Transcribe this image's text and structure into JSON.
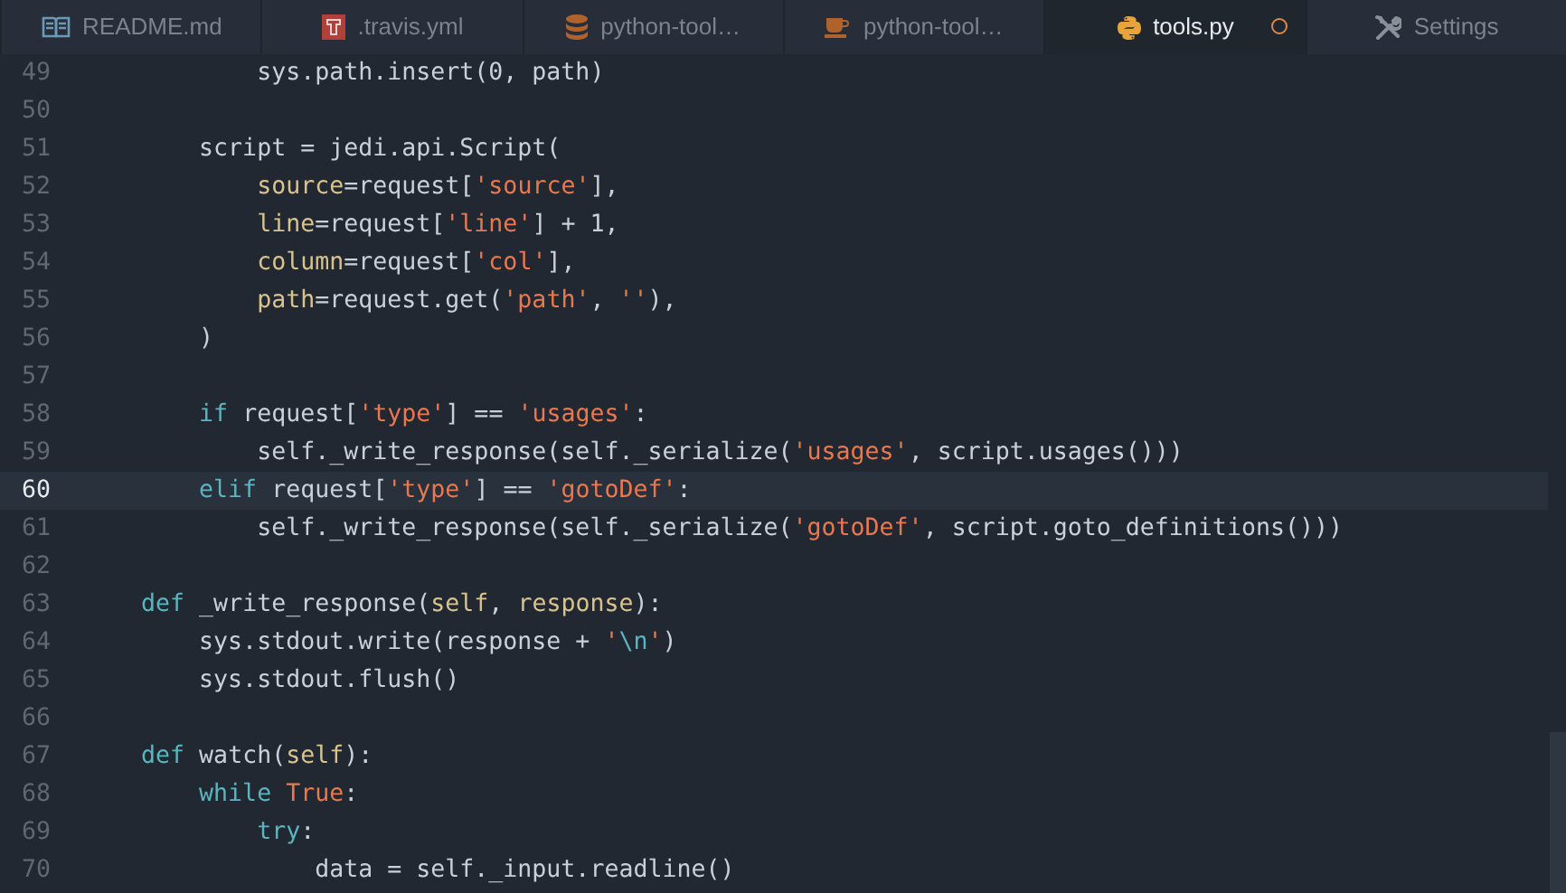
{
  "tabs": [
    {
      "label": "README.md",
      "selected": false,
      "modified": false
    },
    {
      "label": ".travis.yml",
      "selected": false,
      "modified": false
    },
    {
      "label": "python-tool…",
      "selected": false,
      "modified": false
    },
    {
      "label": "python-tool…",
      "selected": false,
      "modified": false
    },
    {
      "label": "tools.py",
      "selected": true,
      "modified": true
    },
    {
      "label": "Settings",
      "selected": false,
      "modified": false
    }
  ],
  "editor": {
    "lines": [
      {
        "number": "49",
        "current": false,
        "tokens": [
          {
            "t": "            sys.path.insert(0, path)",
            "kind": "plain"
          }
        ]
      },
      {
        "number": "50",
        "current": false
      },
      {
        "number": "51",
        "current": false,
        "tokens": [
          {
            "t": "        script = jedi.api.Script(",
            "kind": "plain"
          }
        ]
      },
      {
        "number": "52",
        "current": false,
        "tokens": [
          {
            "t": "            source",
            "kind": "param"
          },
          {
            "t": "=request[",
            "kind": "plain"
          },
          {
            "t": "'source'",
            "kind": "string"
          },
          {
            "t": "],",
            "kind": "plain"
          }
        ]
      },
      {
        "number": "53",
        "current": false,
        "tokens": [
          {
            "t": "            line",
            "kind": "param"
          },
          {
            "t": "=request[",
            "kind": "plain"
          },
          {
            "t": "'line'",
            "kind": "string"
          },
          {
            "t": "] + 1,",
            "kind": "plain"
          }
        ]
      },
      {
        "number": "54",
        "current": false,
        "tokens": [
          {
            "t": "            column",
            "kind": "param"
          },
          {
            "t": "=request[",
            "kind": "plain"
          },
          {
            "t": "'col'",
            "kind": "string"
          },
          {
            "t": "],",
            "kind": "plain"
          }
        ]
      },
      {
        "number": "55",
        "current": false,
        "tokens": [
          {
            "t": "            path",
            "kind": "param"
          },
          {
            "t": "=request.get(",
            "kind": "plain"
          },
          {
            "t": "'path'",
            "kind": "string"
          },
          {
            "t": ", ",
            "kind": "plain"
          },
          {
            "t": "''",
            "kind": "string"
          },
          {
            "t": "),",
            "kind": "plain"
          }
        ]
      },
      {
        "number": "56",
        "current": false,
        "tokens": [
          {
            "t": "        )",
            "kind": "plain"
          }
        ]
      },
      {
        "number": "57",
        "current": false
      },
      {
        "number": "58",
        "current": false,
        "tokens": [
          {
            "t": "        if",
            "kind": "keyword"
          },
          {
            "t": " request[",
            "kind": "plain"
          },
          {
            "t": "'type'",
            "kind": "string"
          },
          {
            "t": "] == ",
            "kind": "plain"
          },
          {
            "t": "'usages'",
            "kind": "string"
          },
          {
            "t": ":",
            "kind": "plain"
          }
        ]
      },
      {
        "number": "59",
        "current": false,
        "tokens": [
          {
            "t": "            self._write_response(self._serialize(",
            "kind": "plain"
          },
          {
            "t": "'usages'",
            "kind": "string"
          },
          {
            "t": ", script.usages()))",
            "kind": "plain"
          }
        ]
      },
      {
        "number": "60",
        "current": true,
        "tokens": [
          {
            "t": "        elif",
            "kind": "keyword"
          },
          {
            "t": " request[",
            "kind": "plain"
          },
          {
            "t": "'type'",
            "kind": "string"
          },
          {
            "t": "] == ",
            "kind": "plain"
          },
          {
            "t": "'gotoDef'",
            "kind": "string"
          },
          {
            "t": ":",
            "kind": "plain"
          }
        ]
      },
      {
        "number": "61",
        "current": false,
        "tokens": [
          {
            "t": "            self._write_response(self._serialize(",
            "kind": "plain"
          },
          {
            "t": "'gotoDef'",
            "kind": "string"
          },
          {
            "t": ", script.goto_definitions()))",
            "kind": "plain"
          }
        ]
      },
      {
        "number": "62",
        "current": false
      },
      {
        "number": "63",
        "current": false,
        "tokens": [
          {
            "t": "    def",
            "kind": "keyword"
          },
          {
            "t": " _write_response(",
            "kind": "plain"
          },
          {
            "t": "self",
            "kind": "param"
          },
          {
            "t": ", ",
            "kind": "plain"
          },
          {
            "t": "response",
            "kind": "param"
          },
          {
            "t": "):",
            "kind": "plain"
          }
        ]
      },
      {
        "number": "64",
        "current": false,
        "tokens": [
          {
            "t": "        sys.stdout.write(response + ",
            "kind": "plain"
          },
          {
            "t": "'",
            "kind": "string"
          },
          {
            "t": "\\n",
            "kind": "escape"
          },
          {
            "t": "'",
            "kind": "string"
          },
          {
            "t": ")",
            "kind": "plain"
          }
        ]
      },
      {
        "number": "65",
        "current": false,
        "tokens": [
          {
            "t": "        sys.stdout.flush()",
            "kind": "plain"
          }
        ]
      },
      {
        "number": "66",
        "current": false
      },
      {
        "number": "67",
        "current": false,
        "tokens": [
          {
            "t": "    def",
            "kind": "keyword"
          },
          {
            "t": " watch(",
            "kind": "plain"
          },
          {
            "t": "self",
            "kind": "param"
          },
          {
            "t": "):",
            "kind": "plain"
          }
        ]
      },
      {
        "number": "68",
        "current": false,
        "tokens": [
          {
            "t": "        while",
            "kind": "keyword"
          },
          {
            "t": " True",
            "kind": "constant"
          },
          {
            "t": ":",
            "kind": "plain"
          }
        ]
      },
      {
        "number": "69",
        "current": false,
        "tokens": [
          {
            "t": "            try",
            "kind": "keyword"
          },
          {
            "t": ":",
            "kind": "plain"
          }
        ]
      },
      {
        "number": "70",
        "current": false,
        "tokens": [
          {
            "t": "                data = self._input.readline()",
            "kind": "plain"
          }
        ]
      }
    ]
  }
}
